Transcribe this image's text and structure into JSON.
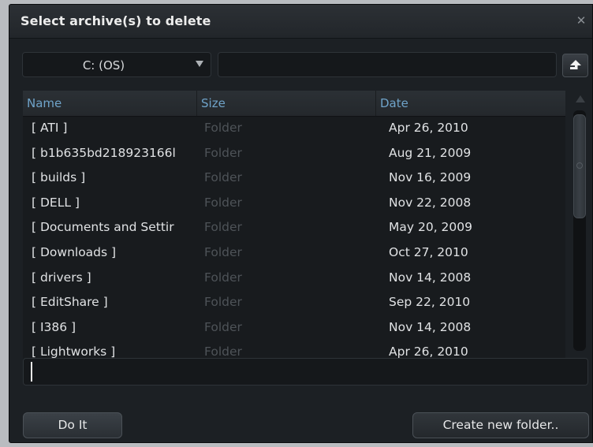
{
  "dialog": {
    "title": "Select archive(s) to delete",
    "close_icon": "close-icon"
  },
  "drive": {
    "selected": "C: (OS)",
    "path_value": ""
  },
  "toolbar": {
    "up_icon": "up-folder-arrow-icon"
  },
  "list": {
    "columns": [
      "Name",
      "Size",
      "Date"
    ],
    "rows": [
      {
        "name": "[ ATI ]",
        "size": "Folder",
        "date": "Apr 26, 2010"
      },
      {
        "name": "[ b1b635bd218923166l",
        "size": "Folder",
        "date": "Aug 21, 2009"
      },
      {
        "name": "[ builds ]",
        "size": "Folder",
        "date": "Nov 16, 2009"
      },
      {
        "name": "[ DELL ]",
        "size": "Folder",
        "date": "Nov 22, 2008"
      },
      {
        "name": "[ Documents and Settir",
        "size": "Folder",
        "date": "May 20, 2009"
      },
      {
        "name": "[ Downloads ]",
        "size": "Folder",
        "date": "Oct 27, 2010"
      },
      {
        "name": "[ drivers ]",
        "size": "Folder",
        "date": "Nov 14, 2008"
      },
      {
        "name": "[ EditShare ]",
        "size": "Folder",
        "date": "Sep 22, 2010"
      },
      {
        "name": "[ I386 ]",
        "size": "Folder",
        "date": "Nov 14, 2008"
      },
      {
        "name": "[ Lightworks ]",
        "size": "Folder",
        "date": "Apr 26, 2010"
      }
    ]
  },
  "filename": {
    "value": ""
  },
  "buttons": {
    "do_it": "Do It",
    "create_folder": "Create new folder.."
  },
  "colors": {
    "background": "#1c2024",
    "header_text": "#6fa3c9",
    "size_text": "#4e5358"
  }
}
